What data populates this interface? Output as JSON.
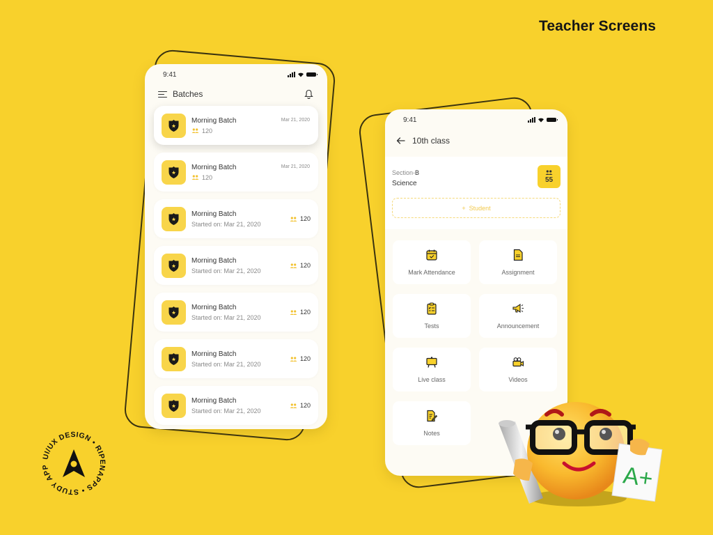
{
  "page_title": "Teacher Screens",
  "badge": {
    "ring_text": "UI/UX DESIGN • RIPENAPPS • STUDY APP •",
    "icon": "navigation-arrow-icon"
  },
  "batches_screen": {
    "status_time": "9:41",
    "title": "Batches",
    "menu_icon": "menu-icon",
    "notification_icon": "bell-icon",
    "batches": [
      {
        "name": "Morning Batch",
        "count": "120",
        "date": "Mar 21, 2020",
        "layout": "compact",
        "active": true
      },
      {
        "name": "Morning Batch",
        "count": "120",
        "date": "Mar 21, 2020",
        "layout": "compact",
        "active": false
      },
      {
        "name": "Morning Batch",
        "count": "120",
        "started": "Started on: Mar 21, 2020",
        "layout": "started"
      },
      {
        "name": "Morning Batch",
        "count": "120",
        "started": "Started on: Mar 21, 2020",
        "layout": "started"
      },
      {
        "name": "Morning Batch",
        "count": "120",
        "started": "Started on: Mar 21, 2020",
        "layout": "started"
      },
      {
        "name": "Morning Batch",
        "count": "120",
        "started": "Started on: Mar 21, 2020",
        "layout": "started"
      },
      {
        "name": "Morning Batch",
        "count": "120",
        "started": "Started on: Mar 21, 2020",
        "layout": "started"
      }
    ]
  },
  "class_screen": {
    "status_time": "9:41",
    "title": "10th class",
    "back_icon": "arrow-left-icon",
    "section_prefix": "Section-",
    "section_value": "B",
    "subject": "Science",
    "student_count": "55",
    "add_student_label": "Student",
    "tiles": [
      {
        "label": "Mark Attendance",
        "icon": "calendar-check-icon"
      },
      {
        "label": "Assignment",
        "icon": "document-icon"
      },
      {
        "label": "Tests",
        "icon": "clipboard-icon"
      },
      {
        "label": "Announcement",
        "icon": "megaphone-icon"
      },
      {
        "label": "Live class",
        "icon": "easel-icon"
      },
      {
        "label": "Videos",
        "icon": "video-camera-icon"
      },
      {
        "label": "Notes",
        "icon": "notes-edit-icon"
      }
    ]
  },
  "mascot": {
    "description": "nerd emoji with glasses holding rolled paper and A+ grade",
    "grade": "A+"
  },
  "colors": {
    "background": "#F8D12C",
    "accent": "#F8D54A",
    "card": "#FFFFFF",
    "screen": "#FDFBF4"
  }
}
